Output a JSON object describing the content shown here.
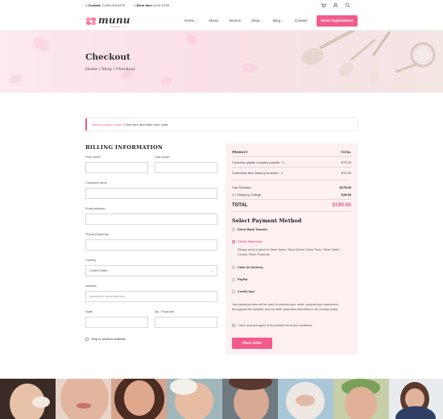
{
  "topbar": {
    "contact_label": "Contact:",
    "contact_value": "1-800-915-6270",
    "hours_label": "Work time:",
    "hours_value": "9:00-19:00",
    "icons": [
      "cart-icon",
      "user-icon",
      "search-icon"
    ]
  },
  "header": {
    "logo_text": "munu",
    "logo_sub": "BEAUTY",
    "nav": [
      {
        "label": "Home",
        "caret": "⌄"
      },
      {
        "label": "About",
        "caret": ""
      },
      {
        "label": "Service",
        "caret": ""
      },
      {
        "label": "Shop",
        "caret": "⌄"
      },
      {
        "label": "Blog",
        "caret": "⌄"
      },
      {
        "label": "Contact",
        "caret": ""
      }
    ],
    "book_button": "Book Appointment"
  },
  "banner": {
    "title": "Checkout",
    "breadcrumb": "Home / Shop / Checkout"
  },
  "coupon": {
    "question": "Have a coupon code?",
    "action": "Click here and enter your code."
  },
  "billing": {
    "title": "BILLING INFORMATION",
    "first_name": "First name*",
    "last_name": "Last name*",
    "company": "Company name",
    "email": "Email address",
    "phone": "Phone (Optional)",
    "country_label": "Country",
    "country_value": "United States",
    "address_label": "Address",
    "address_placeholder": "Apartment, street address",
    "state_label": "State",
    "zip_label": "Zip / Postcode",
    "ship_other": "Ship to another address"
  },
  "order": {
    "head_product": "PRODUCT",
    "head_total": "TOTAL",
    "items": [
      {
        "name": "Cosmetic plastic compact powder * 1",
        "price": "$75.00"
      },
      {
        "name": "Cosmetics and makeup brushes * 1",
        "price": "$70.50"
      }
    ],
    "subtotal_label": "Cart Subtotal",
    "subtotal_value": "$175.00",
    "shipping_label": "(+) Shipping Charge",
    "shipping_value": "$15.00",
    "total_label": "TOTAL",
    "total_value": "$190.00"
  },
  "payment": {
    "title": "Select Payment Method",
    "bank": "Direct Bank Transfer",
    "check": "Check Payments",
    "check_desc": "Please send a check to Store Name, Store Street, Store Town, Store State / County, Store Postcode.",
    "cod": "Cash On Delivery",
    "paypal": "PayPal",
    "card": "Credit Card",
    "privacy": "Your personal data will be used to process your order, support your experience throughout this website, and for other purposes described in our privacy policy.",
    "terms": "I have read and agree to the website terms and conditions",
    "place_order": "Place Order"
  },
  "colors": {
    "accent": "#f25c8c",
    "summary_bg": "#fcf0f1",
    "banner_bg": "#fbe0e7"
  },
  "gallery_count": 8
}
